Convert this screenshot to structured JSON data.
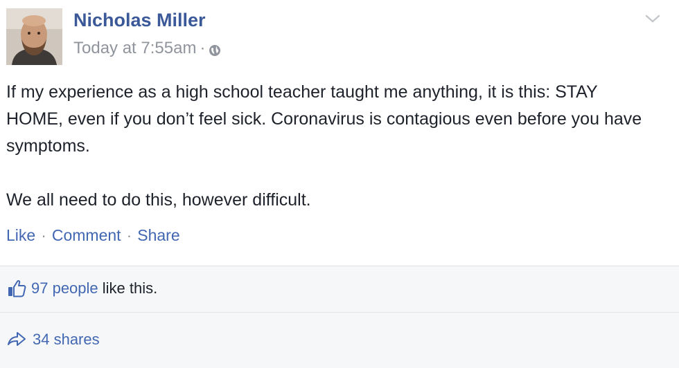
{
  "post": {
    "author": "Nicholas Miller",
    "timestamp": "Today at 7:55am",
    "meta_separator": "·",
    "privacy_icon": "globe-icon",
    "menu_icon": "chevron-down-icon",
    "body": {
      "paragraph_1": "If my experience as a high school teacher taught me anything, it is this: STAY HOME, even if you don’t feel sick. Coronavirus is contagious even before you have symptoms.",
      "paragraph_2": "We all need to do this, however difficult."
    },
    "actions": {
      "like": "Like",
      "comment": "Comment",
      "share": "Share",
      "separator": "·"
    },
    "likes": {
      "icon": "thumbs-up-icon",
      "count_link": "97 people",
      "suffix": " like this."
    },
    "shares": {
      "icon": "share-arrow-icon",
      "text": "34 shares"
    }
  },
  "colors": {
    "link": "#4267b2",
    "author": "#3b5998",
    "meta": "#90949c",
    "text": "#1d2129",
    "footer_bg": "#f6f7f9"
  }
}
